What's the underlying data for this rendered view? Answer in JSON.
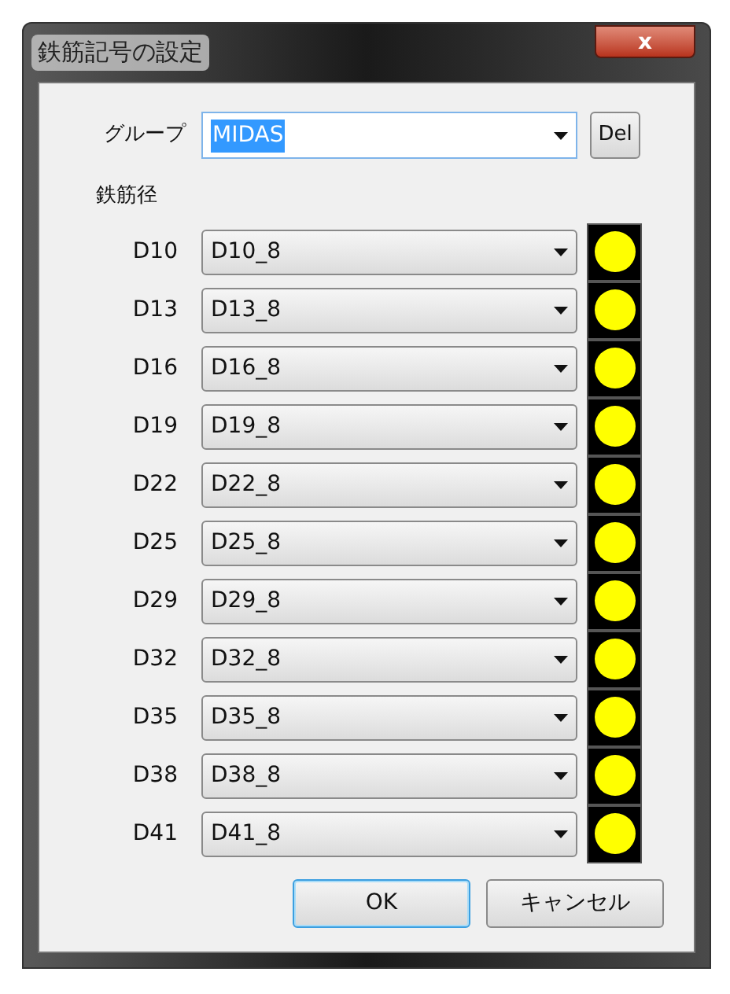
{
  "window": {
    "title": "鉄筋記号の設定",
    "close": "x"
  },
  "group": {
    "label": "グループ",
    "value": "MIDAS",
    "selected_text": true,
    "delete_button": "Del"
  },
  "section_label": "鉄筋径",
  "rows": [
    {
      "label": "D10",
      "value": "D10_8",
      "color": "#ffff00"
    },
    {
      "label": "D13",
      "value": "D13_8",
      "color": "#ffff00"
    },
    {
      "label": "D16",
      "value": "D16_8",
      "color": "#ffff00"
    },
    {
      "label": "D19",
      "value": "D19_8",
      "color": "#ffff00"
    },
    {
      "label": "D22",
      "value": "D22_8",
      "color": "#ffff00"
    },
    {
      "label": "D25",
      "value": "D25_8",
      "color": "#ffff00"
    },
    {
      "label": "D29",
      "value": "D29_8",
      "color": "#ffff00"
    },
    {
      "label": "D32",
      "value": "D32_8",
      "color": "#ffff00"
    },
    {
      "label": "D35",
      "value": "D35_8",
      "color": "#ffff00"
    },
    {
      "label": "D38",
      "value": "D38_8",
      "color": "#ffff00"
    },
    {
      "label": "D41",
      "value": "D41_8",
      "color": "#ffff00"
    }
  ],
  "buttons": [
    {
      "label": "OK",
      "default": true
    },
    {
      "label": "キャンセル",
      "default": false
    }
  ]
}
